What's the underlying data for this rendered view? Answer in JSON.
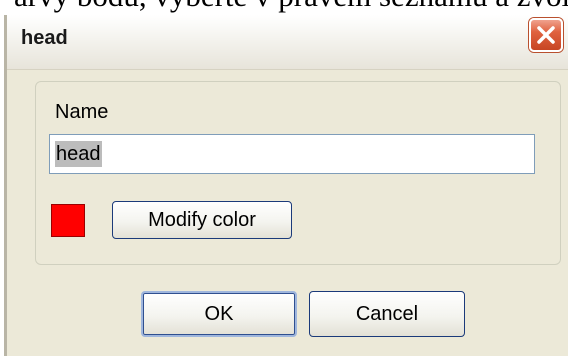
{
  "background": {
    "text": "arvy bodu, vyberte v pravém seznamu a zvol"
  },
  "dialog": {
    "title": "head",
    "close_icon": "close-x-icon",
    "name_label": "Name",
    "name_value": "head",
    "swatch_color": "#ff0000",
    "modify_label": "Modify color",
    "ok_label": "OK",
    "cancel_label": "Cancel"
  }
}
